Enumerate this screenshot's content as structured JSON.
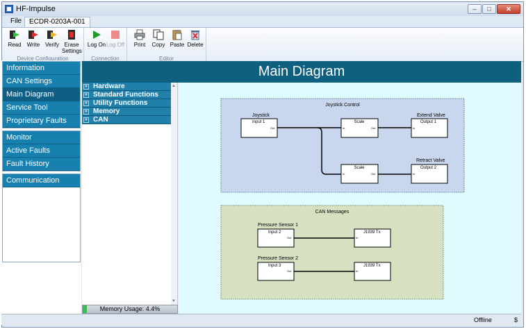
{
  "window": {
    "title": "HF-Impulse"
  },
  "menu": {
    "file": "File",
    "device_tab": "ECDR-0203A-001"
  },
  "ribbon": {
    "groups": [
      {
        "label": "Device Configuration",
        "buttons": [
          "Read",
          "Write",
          "Verify",
          "Erase Settings"
        ]
      },
      {
        "label": "Connection",
        "buttons": [
          "Log On",
          "Log Off"
        ]
      },
      {
        "label": "Editor",
        "buttons": [
          "Print",
          "Copy",
          "Paste",
          "Delete"
        ]
      }
    ]
  },
  "nav": {
    "group1": [
      "Information",
      "CAN Settings",
      "Main Diagram",
      "Service Tool",
      "Proprietary Faults"
    ],
    "group2": [
      "Monitor",
      "Active Faults",
      "Fault History"
    ],
    "group3": [
      "Communication"
    ]
  },
  "tree": {
    "items": [
      "Hardware",
      "Standard Functions",
      "Utility Functions",
      "Memory",
      "CAN"
    ],
    "memory_label": "Memory Usage: 4.4%",
    "memory_fraction": 0.044
  },
  "main": {
    "title": "Main Diagram"
  },
  "diagram": {
    "joystick_group": "Joystick Control",
    "can_group": "CAN Messages",
    "blocks": {
      "joystick_label": "Joystick",
      "joystick_block": "Input 1",
      "scale1": "Scale",
      "scale2": "Scale",
      "extend_label": "Extend Valve",
      "extend_block": "Output 1",
      "retract_label": "Retract Valve",
      "retract_block": "Output 2",
      "ps1_label": "Pressure Sensor 1",
      "ps1_block": "Input 2",
      "ps2_label": "Pressure Sensor 2",
      "ps2_block": "Input 3",
      "tx1": "J1939 Tx",
      "tx2": "J1939 Tx",
      "port_out": "Out",
      "port_in": "In"
    }
  },
  "status": {
    "state": "Offline",
    "extra": "$"
  },
  "colors": {
    "nav_blue": "#1780ae",
    "nav_active": "#0f5f84",
    "header": "#0f5f7e",
    "canvas": "#e0fbfd",
    "group_joystick": "#c8d7ee",
    "group_can": "#d5e1c0"
  }
}
